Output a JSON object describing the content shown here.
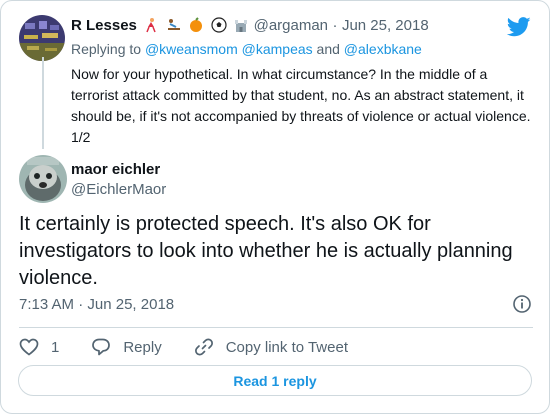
{
  "parent_tweet": {
    "author_name": "R Lesses",
    "emoji_icons": [
      "dancer-emoji",
      "sledding-emoji",
      "orange-emoji",
      "soccer-ball-emoji",
      "castle-emoji"
    ],
    "handle": "@argaman",
    "separator": "·",
    "date": "Jun 25, 2018",
    "replying_to_label": "Replying to",
    "mentions": [
      "@kweansmom",
      "@kampeas",
      "and",
      "@alexbkane"
    ],
    "text": "Now for your hypothetical. In what circumstance? In the middle of a terrorist attack committed by that student, no. As an abstract statement, it should be, if it's not accompanied by threats of violence or actual violence. 1/2"
  },
  "main_tweet": {
    "author_name": "maor eichler",
    "handle": "@EichlerMaor",
    "text": "It certainly is protected speech. It's also OK for investigators to look into whether he is actually planning violence.",
    "time": "7:13 AM",
    "separator": "·",
    "date": "Jun 25, 2018"
  },
  "actions": {
    "like_count": "1",
    "reply_label": "Reply",
    "copy_link_label": "Copy link to Tweet"
  },
  "read_replies_label": "Read 1 reply",
  "colors": {
    "accent": "#1b95e0",
    "twitter_blue": "#1d9bf0",
    "text": "#0f1419",
    "muted": "#536471",
    "border": "#cfd9de"
  },
  "icons": [
    "twitter-bird-icon",
    "info-icon",
    "heart-icon",
    "reply-icon",
    "link-icon"
  ]
}
